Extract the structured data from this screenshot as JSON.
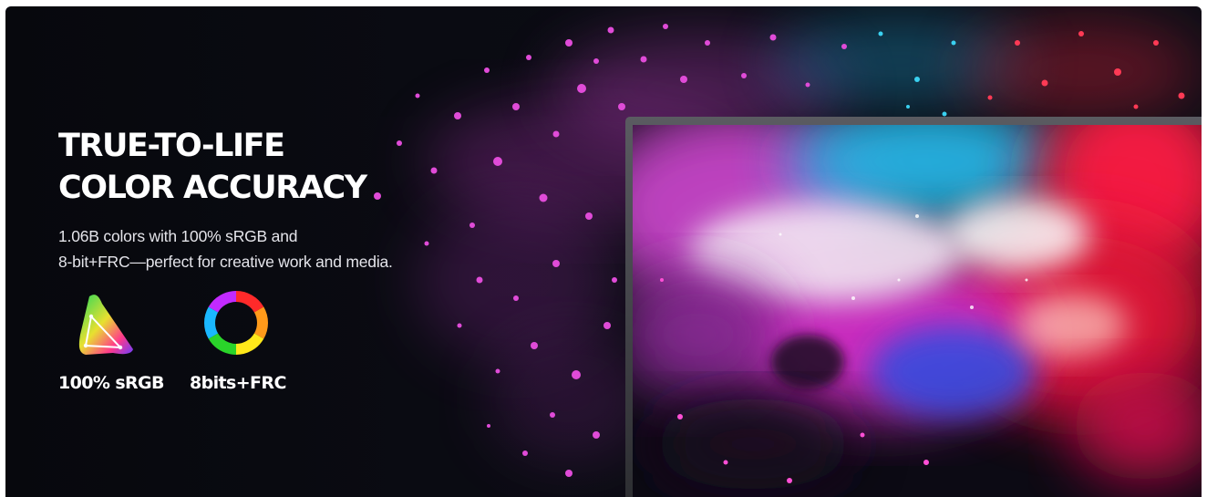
{
  "banner": {
    "headline": [
      "TRUE-TO-LIFE",
      "COLOR ACCURACY"
    ],
    "description": [
      "1.06B colors with 100% sRGB and",
      "8-bit+FRC—perfect for creative work and media."
    ],
    "features": [
      {
        "icon": "color-gamut-triangle-icon",
        "label": "100% sRGB"
      },
      {
        "icon": "color-wheel-ring-icon",
        "label": "8bits+FRC"
      }
    ],
    "colors": {
      "background": "#07080d",
      "magenta": "#e23ad8",
      "cyan": "#2ad4f2",
      "red": "#ff1f45",
      "white_cloud": "#f6e8f4",
      "monitor_bezel": "#3a3b40"
    }
  }
}
